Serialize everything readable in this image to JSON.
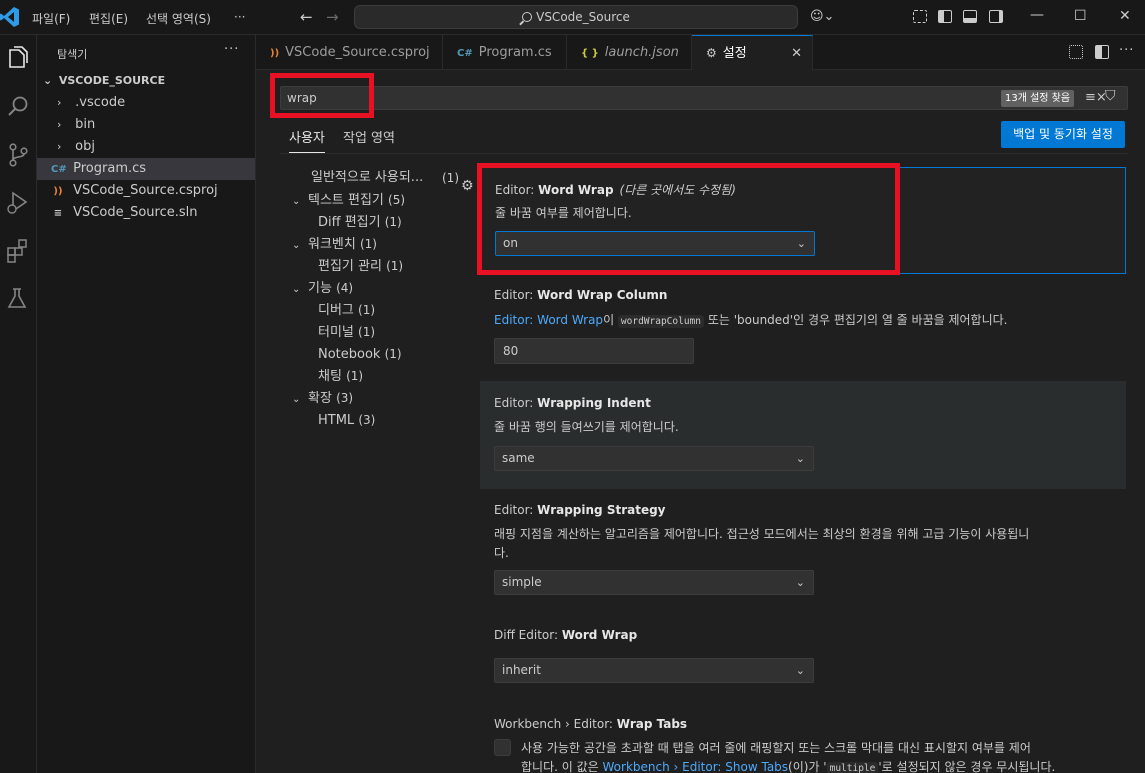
{
  "titlebar": {
    "menus": [
      "파일(F)",
      "편집(E)",
      "선택 영역(S)",
      "···"
    ],
    "search_text": "VSCode_Source",
    "icons": [
      "vscode-logo",
      "back-arrow-icon",
      "forward-arrow-icon",
      "search-icon",
      "copilot-icon",
      "customize-layout-icon",
      "toggle-primary-sidebar-icon",
      "toggle-panel-icon",
      "toggle-secondary-sidebar-icon",
      "minimize-icon",
      "maximize-icon",
      "close-icon"
    ],
    "back_glyph": "←",
    "forward_glyph": "→",
    "copilot_glyph": "☺⌄",
    "win_minimize": "—",
    "win_maximize": "☐",
    "win_close": "✕"
  },
  "activitybar": {
    "items": [
      "explorer-icon",
      "search-icon",
      "source-control-icon",
      "run-debug-icon",
      "extensions-icon",
      "testing-icon"
    ]
  },
  "sidebar": {
    "title": "탐색기",
    "more": "···",
    "root": "VSCODE_SOURCE",
    "root_chevron": "⌄",
    "items": [
      {
        "label": ".vscode",
        "kind": "folder",
        "chevron": "›"
      },
      {
        "label": "bin",
        "kind": "folder",
        "chevron": "›"
      },
      {
        "label": "obj",
        "kind": "folder",
        "chevron": "›"
      },
      {
        "label": "Program.cs",
        "kind": "csharp",
        "icon": "C#",
        "selected": true
      },
      {
        "label": "VSCode_Source.csproj",
        "kind": "rss",
        "icon": "))"
      },
      {
        "label": "VSCode_Source.sln",
        "kind": "sln",
        "icon": "≡"
      }
    ]
  },
  "tabs": [
    {
      "label": "VSCode_Source.csproj",
      "icon": "))",
      "icon_color": "#e8823a"
    },
    {
      "label": "Program.cs",
      "icon": "C#",
      "icon_color": "#519aba"
    },
    {
      "label": "launch.json",
      "icon": "{ }",
      "icon_color": "#cbcb41",
      "italic": true
    },
    {
      "label": "설정",
      "icon": "⚙",
      "icon_color": "#cccccc",
      "active": true,
      "close": "✕"
    }
  ],
  "settings": {
    "search_value": "wrap",
    "found_badge": "13개 설정 찾음",
    "clear_glyph": "≡×",
    "filter_glyph": "⛉",
    "scope_tabs": [
      "사용자",
      "작업 영역"
    ],
    "sync_button": "백업 및 동기화 설정",
    "toc": [
      {
        "label": "일반적으로 사용되...",
        "count": "(1)",
        "level": 0,
        "chev": ""
      },
      {
        "label": "텍스트 편집기",
        "count": "(5)",
        "level": 0,
        "chev": "⌄"
      },
      {
        "label": "Diff 편집기",
        "count": "(1)",
        "level": 1,
        "chev": ""
      },
      {
        "label": "워크벤치",
        "count": "(1)",
        "level": 0,
        "chev": "⌄"
      },
      {
        "label": "편집기 관리",
        "count": "(1)",
        "level": 1,
        "chev": ""
      },
      {
        "label": "기능",
        "count": "(4)",
        "level": 0,
        "chev": "⌄"
      },
      {
        "label": "디버그",
        "count": "(1)",
        "level": 1,
        "chev": ""
      },
      {
        "label": "터미널",
        "count": "(1)",
        "level": 1,
        "chev": ""
      },
      {
        "label": "Notebook",
        "count": "(1)",
        "level": 1,
        "chev": ""
      },
      {
        "label": "채팅",
        "count": "(1)",
        "level": 1,
        "chev": ""
      },
      {
        "label": "확장",
        "count": "(3)",
        "level": 0,
        "chev": "⌄"
      },
      {
        "label": "HTML",
        "count": "(3)",
        "level": 1,
        "chev": ""
      }
    ],
    "gear_glyph": "⚙",
    "items": [
      {
        "category": "Editor: ",
        "name": "Word Wrap",
        "modified": "(다른 곳에서도 수정됨)",
        "description": "줄 바꿈 여부를 제어합니다.",
        "value": "on"
      },
      {
        "category": "Editor: ",
        "name": "Word Wrap Column",
        "desc_link": "Editor: Word Wrap",
        "desc_after_link": "이 ",
        "desc_code": "wordWrapColumn",
        "desc_rest": " 또는 'bounded'인 경우 편집기의 열 줄 바꿈을 제어합니다.",
        "value": "80"
      },
      {
        "category": "Editor: ",
        "name": "Wrapping Indent",
        "description": "줄 바꿈 행의 들여쓰기를 제어합니다.",
        "value": "same"
      },
      {
        "category": "Editor: ",
        "name": "Wrapping Strategy",
        "description_line1": "래핑 지점을 계산하는 알고리즘을 제어합니다. 접근성 모드에서는 최상의 환경을 위해 고급 기능이 사용됩니",
        "description_line2": "다.",
        "value": "simple"
      },
      {
        "category": "Diff Editor: ",
        "name": "Word Wrap",
        "value": "inherit"
      },
      {
        "category": "Workbench › Editor: ",
        "name": "Wrap Tabs",
        "description_line1": "사용 가능한 공간을 초과할 때 탭을 여러 줄에 래핑할지 또는 스크롤 막대를 대신 표시할지 여부를 제어",
        "desc2_prefix": "합니다. 이 값은 ",
        "desc2_link": "Workbench › Editor: Show Tabs",
        "desc2_mid": "(이)가 '",
        "desc2_code": "multiple",
        "desc2_suffix": "'로 설정되지 않은 경우 무시됩니다."
      }
    ],
    "dropdown_arrow": "⌄"
  },
  "colors": {
    "accent": "#0078d4",
    "highlight": "#e81123",
    "link": "#4daafc"
  }
}
